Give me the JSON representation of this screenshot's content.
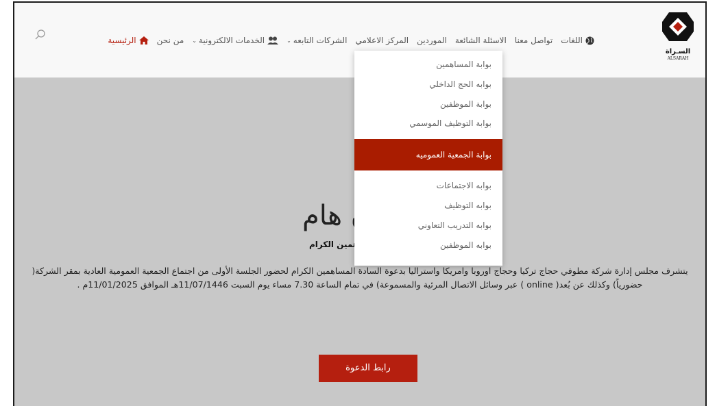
{
  "logo": {
    "ar": "السـراة",
    "en": "ALSARAH"
  },
  "nav": {
    "items": [
      {
        "key": "home",
        "label": "الرئيسية",
        "active": true,
        "icon": "home-icon"
      },
      {
        "key": "about",
        "label": "من نحن"
      },
      {
        "key": "eservices",
        "label": "الخدمات الالكترونية",
        "icon": "users-icon",
        "dropdown": true
      },
      {
        "key": "subsidiaries",
        "label": "الشركات التابعه",
        "dropdown": true
      },
      {
        "key": "media",
        "label": "المركز الاعلامي"
      },
      {
        "key": "suppliers",
        "label": "الموردين"
      },
      {
        "key": "faq",
        "label": "الاسئلة الشائعة"
      },
      {
        "key": "contact",
        "label": "تواصل معنا"
      },
      {
        "key": "languages",
        "label": "اللغات",
        "icon": "globe-icon"
      }
    ]
  },
  "dropdown": {
    "items": [
      "بوابة المساهمين",
      "بوابه الحج الداخلي",
      "بوابة الموظفين",
      "بوابة التوظيف الموسمي",
      "بوابة الجمعية العموميه",
      "بوابه الاجتماعات",
      "بوابه التوظيف",
      "بوابه التدريب التعاوني",
      "بوابه الموظفين"
    ],
    "active_index": 4
  },
  "content": {
    "title": "ن هام",
    "subtitle": "اهمين الكرام",
    "body": "يتشرف مجلس إدارة شركة مطوفي حجاج تركيا وحجاج اوروبا وامريكا واستراليا بدعوة السادة المساهمين الكرام لحضور الجلسة الأولى من اجتماع الجمعية العمومية العادية بمقر الشركة( حضورياً) وكذلك عن بُعد( online ) عبر وسائل الاتصال المرئية والمسموعة) في تمام الساعة 7.30 مساء يوم السبت 11/07/1446هـ الموافق 11/01/2025م .",
    "cta_label": "رابط الدعوة"
  },
  "colors": {
    "accent": "#b51f0f",
    "dropdown_active": "#a91c00",
    "background": "#c8c8c8",
    "header": "#f8f8f8"
  }
}
